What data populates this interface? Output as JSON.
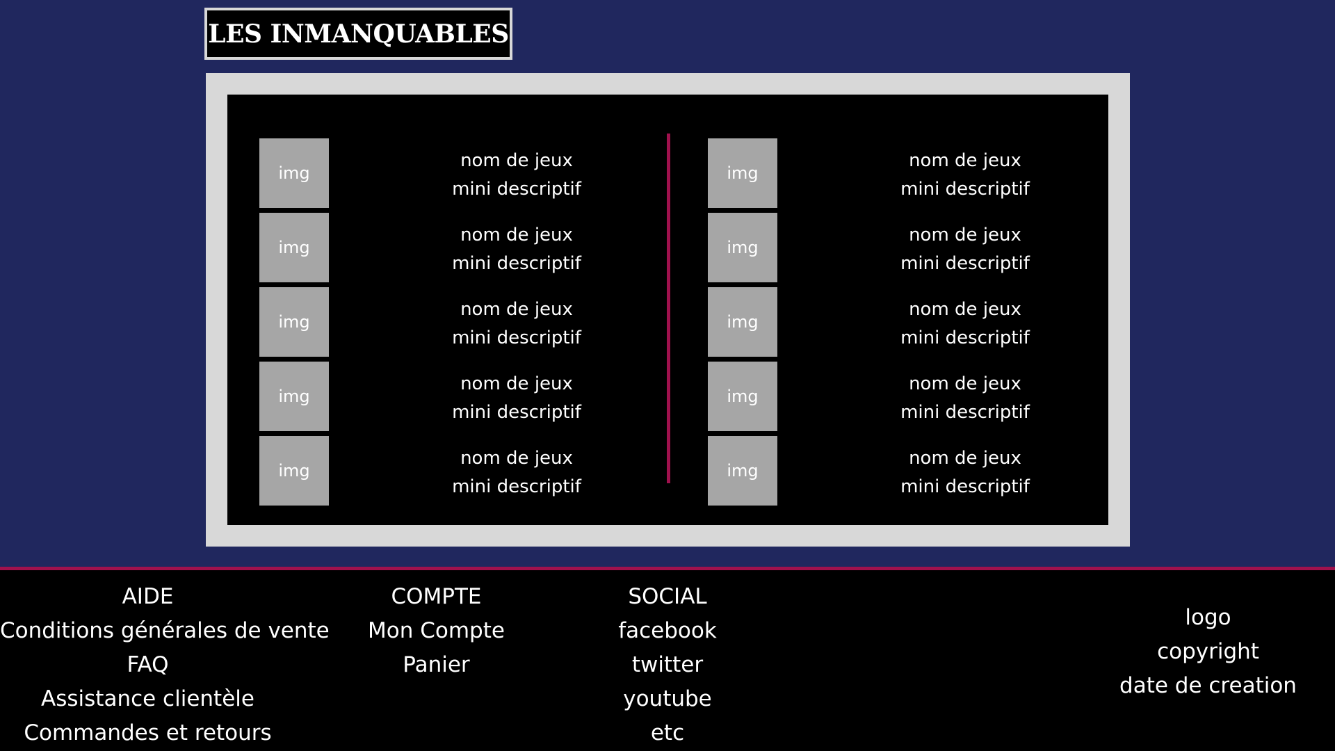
{
  "header": {
    "title": "LES INMANQUABLES"
  },
  "games": {
    "left": [
      {
        "img": "img",
        "name": "nom de jeux",
        "desc": "mini descriptif"
      },
      {
        "img": "img",
        "name": "nom de jeux",
        "desc": "mini descriptif"
      },
      {
        "img": "img",
        "name": "nom de jeux",
        "desc": "mini descriptif"
      },
      {
        "img": "img",
        "name": "nom de jeux",
        "desc": "mini descriptif"
      },
      {
        "img": "img",
        "name": "nom de jeux",
        "desc": "mini descriptif"
      }
    ],
    "right": [
      {
        "img": "img",
        "name": "nom de jeux",
        "desc": "mini descriptif"
      },
      {
        "img": "img",
        "name": "nom de jeux",
        "desc": "mini descriptif"
      },
      {
        "img": "img",
        "name": "nom de jeux",
        "desc": "mini descriptif"
      },
      {
        "img": "img",
        "name": "nom de jeux",
        "desc": "mini descriptif"
      },
      {
        "img": "img",
        "name": "nom de jeux",
        "desc": "mini descriptif"
      }
    ]
  },
  "footer": {
    "aide": {
      "heading": "AIDE",
      "links": [
        "Conditions générales de vente",
        "FAQ",
        "Assistance clientèle",
        "Commandes et retours"
      ]
    },
    "compte": {
      "heading": "COMPTE",
      "links": [
        "Mon Compte",
        "Panier"
      ]
    },
    "social": {
      "heading": "SOCIAL",
      "links": [
        "facebook",
        "twitter",
        "youtube",
        "etc"
      ]
    },
    "brand": [
      "logo",
      "copyright",
      "date de creation"
    ]
  },
  "colors": {
    "background": "#20275e",
    "accent": "#a0114d",
    "frame": "#d8d8d8",
    "thumbnail": "#a6a6a6"
  }
}
